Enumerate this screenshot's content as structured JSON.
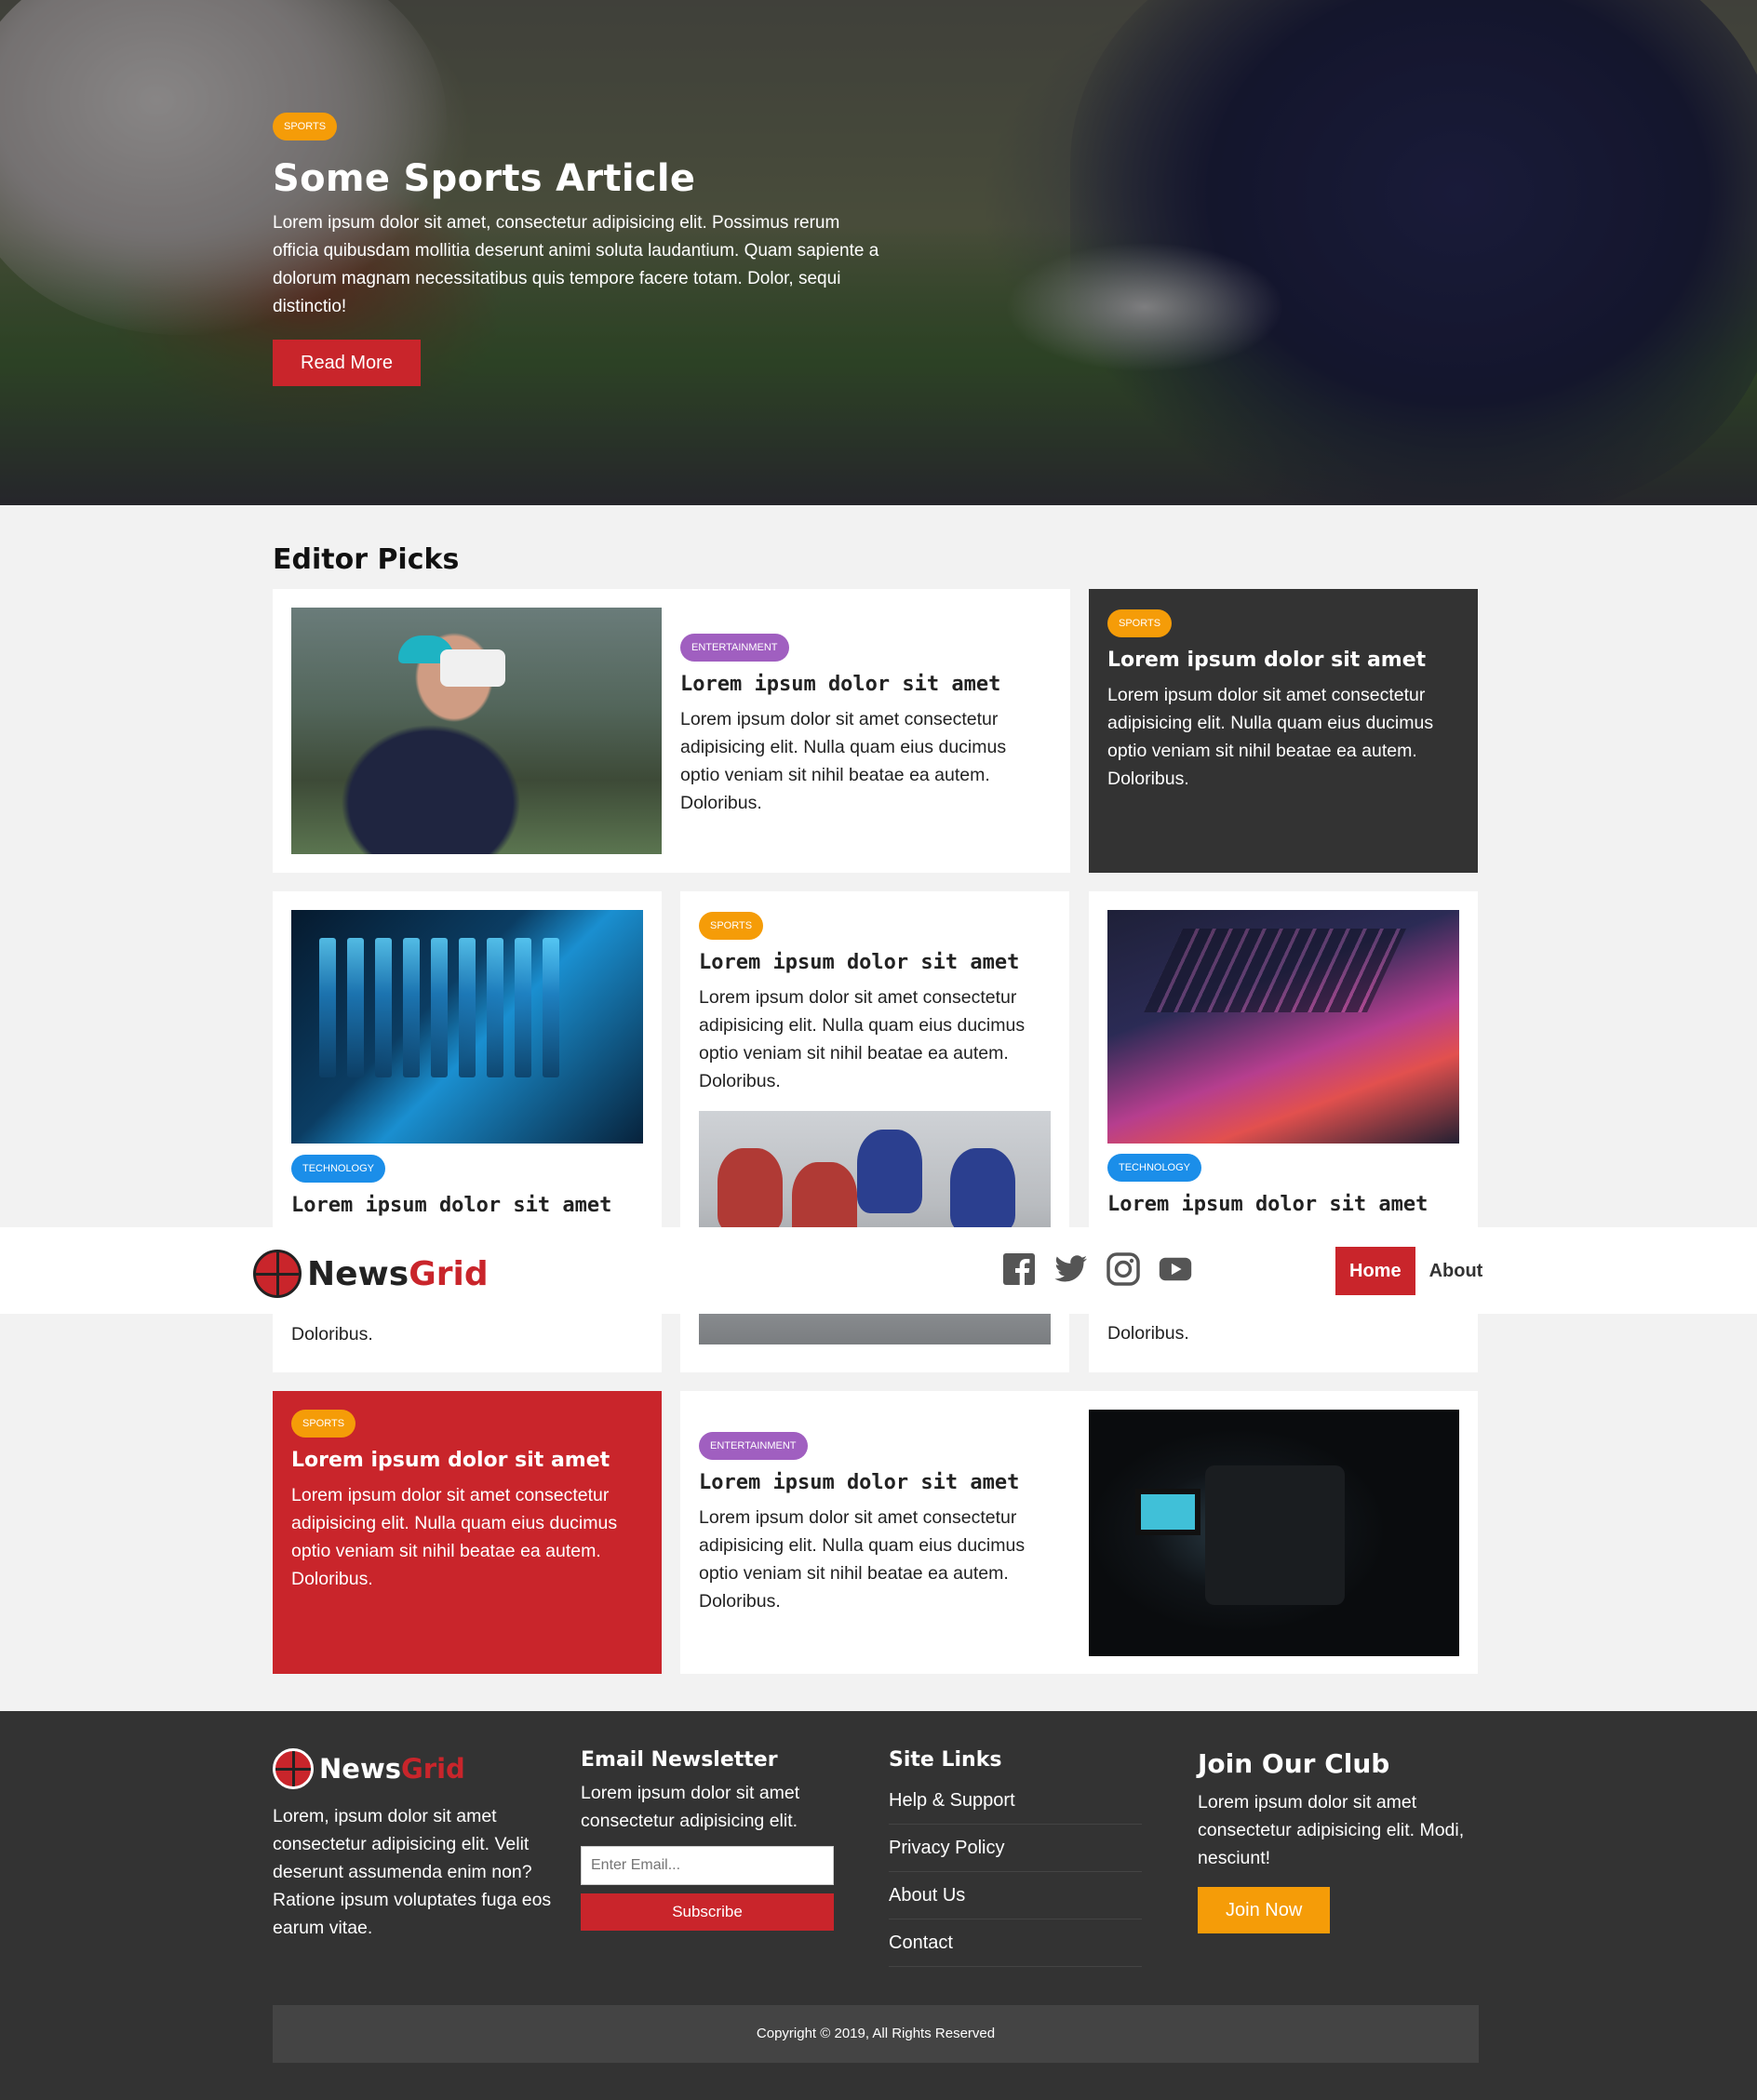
{
  "hero": {
    "badge": "SPORTS",
    "title": "Some Sports Article",
    "text": "Lorem ipsum dolor sit amet, consectetur adipisicing elit. Possimus rerum officia quibusdam mollitia deserunt animi soluta laudantium. Quam sapiente a dolorum magnam necessitatibus quis tempore facere totam. Dolor, sequi distinctio!",
    "button": "Read More"
  },
  "section": {
    "title": "Editor Picks"
  },
  "cards": {
    "c1": {
      "badge": "ENTERTAINMENT",
      "title": "Lorem ipsum dolor sit amet",
      "text": "Lorem ipsum dolor sit amet consectetur adipisicing elit. Nulla quam eius ducimus optio veniam sit nihil beatae ea autem. Doloribus."
    },
    "c2": {
      "badge": "SPORTS",
      "title": "Lorem ipsum dolor sit amet",
      "text": "Lorem ipsum dolor sit amet consectetur adipisicing elit. Nulla quam eius ducimus optio veniam sit nihil beatae ea autem. Doloribus."
    },
    "c3": {
      "badge": "TECHNOLOGY",
      "title": "Lorem ipsum dolor sit amet",
      "text": "Doloribus."
    },
    "c4": {
      "badge": "SPORTS",
      "title": "Lorem ipsum dolor sit amet",
      "text": "Lorem ipsum dolor sit amet consectetur adipisicing elit. Nulla quam eius ducimus optio veniam sit nihil beatae ea autem. Doloribus."
    },
    "c5": {
      "badge": "TECHNOLOGY",
      "title": "Lorem ipsum dolor sit amet",
      "text": "Doloribus."
    },
    "c6": {
      "badge": "SPORTS",
      "title": "Lorem ipsum dolor sit amet",
      "text": "Lorem ipsum dolor sit amet consectetur adipisicing elit. Nulla quam eius ducimus optio veniam sit nihil beatae ea autem. Doloribus."
    },
    "c7": {
      "badge": "ENTERTAINMENT",
      "title": "Lorem ipsum dolor sit amet",
      "text": "Lorem ipsum dolor sit amet consectetur adipisicing elit. Nulla quam eius ducimus optio veniam sit nihil beatae ea autem. Doloribus."
    }
  },
  "navbar": {
    "logo_a": "News",
    "logo_b": "Grid",
    "social": [
      "facebook-icon",
      "twitter-icon",
      "instagram-icon",
      "youtube-icon"
    ],
    "links": {
      "home": "Home",
      "about": "About"
    }
  },
  "footer": {
    "logo_a": "News",
    "logo_b": "Grid",
    "about_text": "Lorem, ipsum dolor sit amet consectetur adipisicing elit. Velit deserunt assumenda enim non? Ratione ipsum voluptates fuga eos earum vitae.",
    "newsletter": {
      "title": "Email Newsletter",
      "text": "Lorem ipsum dolor sit amet consectetur adipisicing elit.",
      "placeholder": "Enter Email...",
      "button": "Subscribe"
    },
    "site_links": {
      "title": "Site Links",
      "items": [
        "Help & Support",
        "Privacy Policy",
        "About Us",
        "Contact"
      ]
    },
    "club": {
      "title": "Join Our Club",
      "text": "Lorem ipsum dolor sit amet consectetur adipisicing elit. Modi, nesciunt!",
      "button": "Join Now"
    },
    "copyright": "Copyright © 2019, All Rights Reserved"
  },
  "colors": {
    "brand_red": "#c9252b",
    "sports": "#f59c08",
    "entertainment": "#a05fc0",
    "technology": "#1b8ee9",
    "dark": "#333333"
  }
}
